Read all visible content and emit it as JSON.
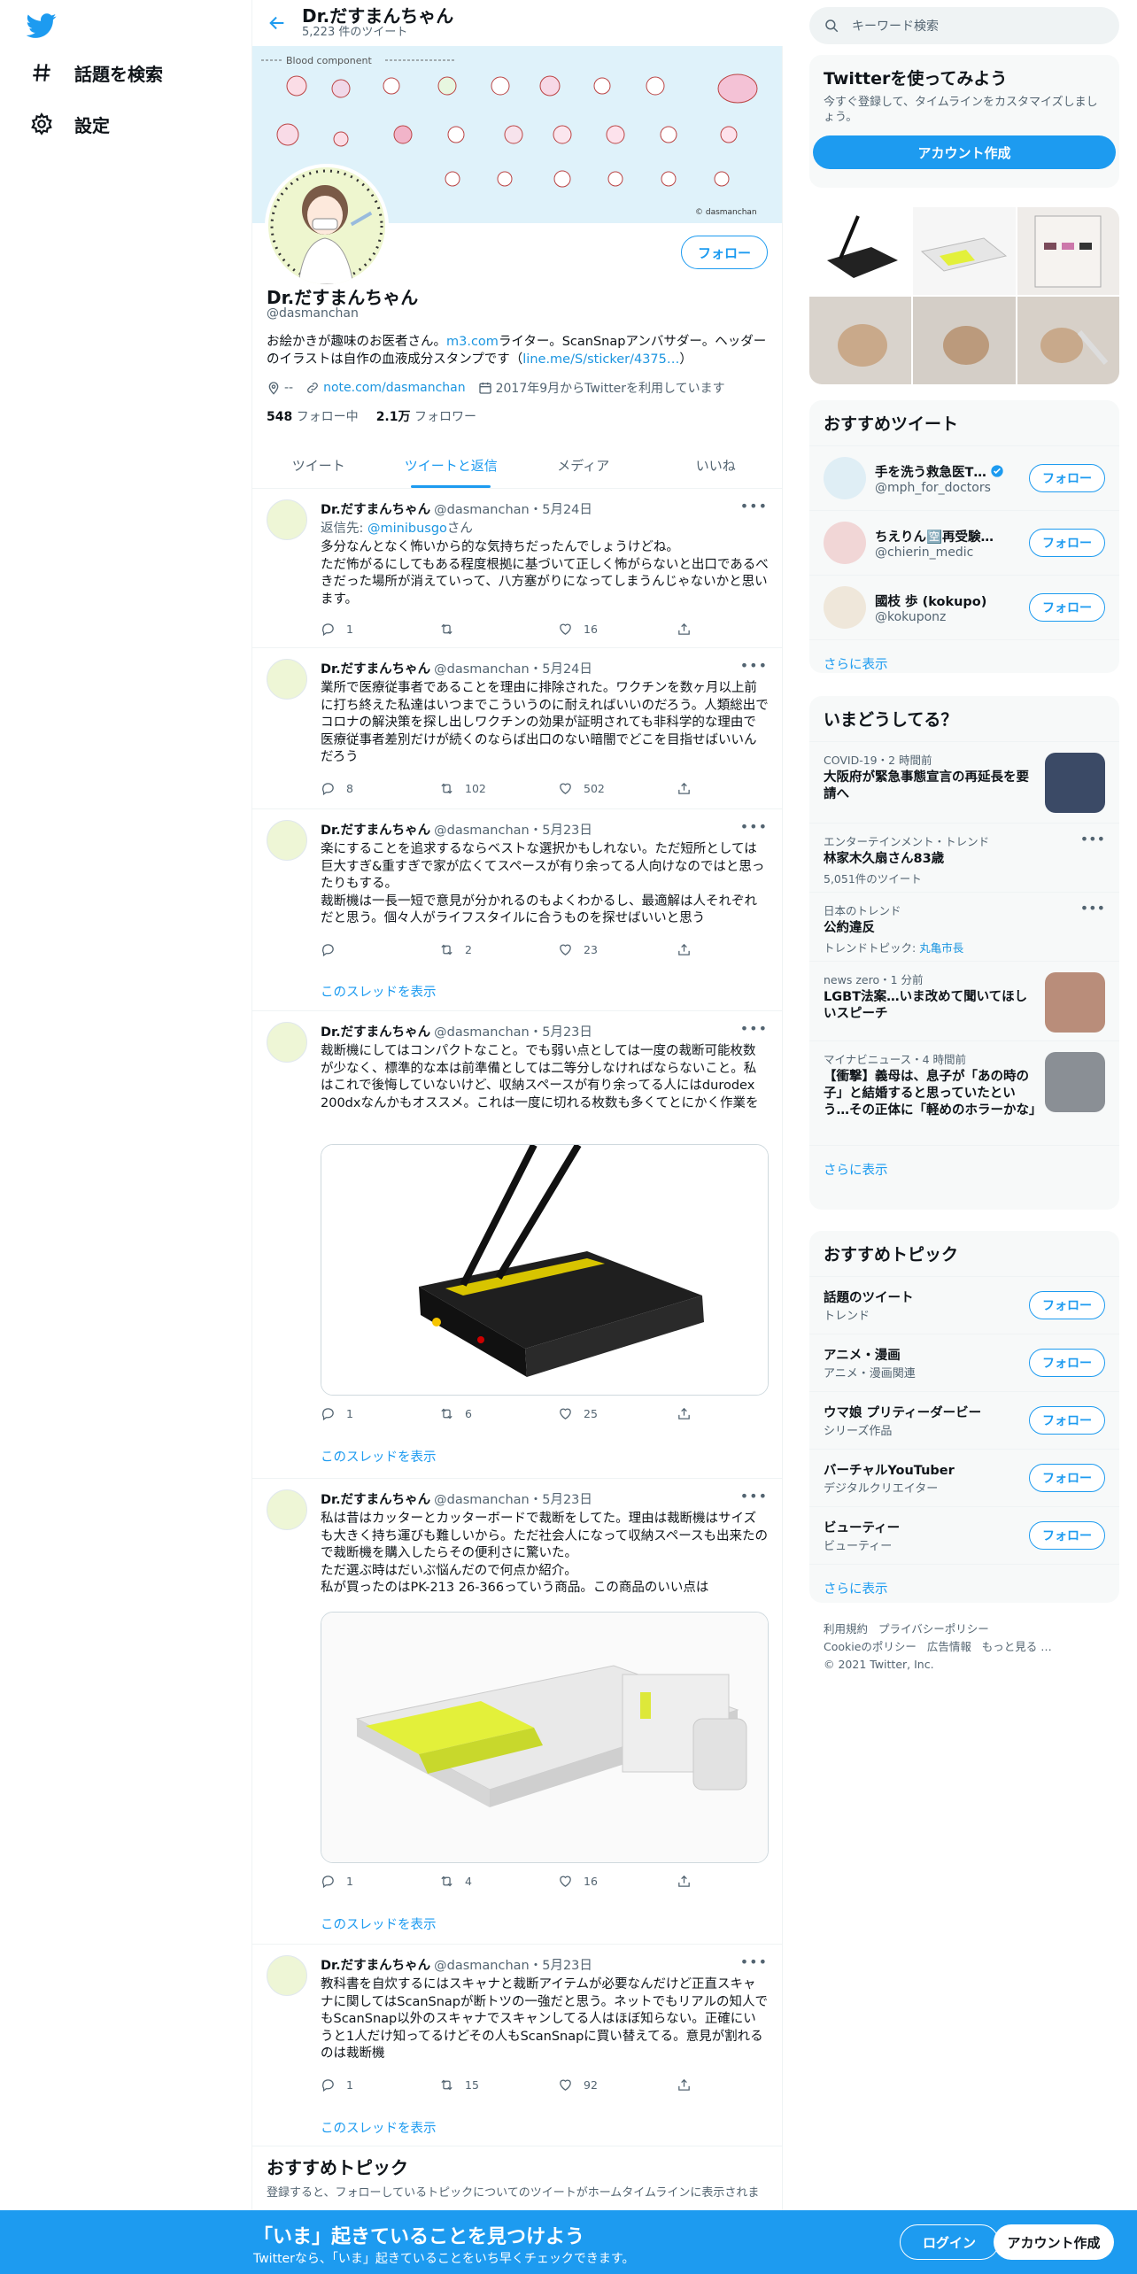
{
  "nav": {
    "explore": "話題を検索",
    "settings": "設定"
  },
  "profile": {
    "header_name": "Dr.だすまんちゃん",
    "tweet_count": "5,223 件のツイート",
    "follow_button": "フォロー",
    "name": "Dr.だすまんちゃん",
    "handle": "@dasmanchan",
    "bio_pre": "お絵かきが趣味のお医者さん。",
    "bio_link1": "m3.com",
    "bio_mid": "ライター。ScanSnapアンバサダー。ヘッダーのイラストは自作の血液成分スタンプです（",
    "bio_link2": "line.me/S/sticker/4375…",
    "bio_post": "）",
    "location": "--",
    "website": "note.com/dasmanchan",
    "joined": "2017年9月からTwitterを利用しています",
    "following_count": "548",
    "following_label": "フォロー中",
    "followers_count": "2.1万",
    "followers_label": "フォロワー",
    "banner_caption": "Blood component",
    "banner_credit": "© dasmanchan"
  },
  "tabs": [
    "ツイート",
    "ツイートと返信",
    "メディア",
    "いいね"
  ],
  "tweets": [
    {
      "name": "Dr.だすまんちゃん",
      "meta": "@dasmanchan・5月24日",
      "reply_prefix": "返信先: ",
      "reply_to": "@minibusgo",
      "reply_suffix": "さん",
      "body": "多分なんとなく怖いから的な気持ちだったんでしょうけどね。\nただ怖がるにしてもある程度根拠に基づいて正しく怖がらないと出口であるべきだった場所が消えていって、八方塞がりになってしまうんじゃないかと思います。",
      "reply": "1",
      "retweet": "",
      "like": "16"
    },
    {
      "name": "Dr.だすまんちゃん",
      "meta": "@dasmanchan・5月24日",
      "body": "業所で医療従事者であることを理由に排除された。ワクチンを数ヶ月以上前に打ち終えた私達はいつまでこういうのに耐えればいいのだろう。人類総出でコロナの解決策を探し出しワクチンの効果が証明されても非科学的な理由で医療従事者差別だけが続くのならば出口のない暗闇でどこを目指せばいいんだろう",
      "reply": "8",
      "retweet": "102",
      "like": "502"
    },
    {
      "name": "Dr.だすまんちゃん",
      "meta": "@dasmanchan・5月23日",
      "body": "楽にすることを追求するならベストな選択かもしれない。ただ短所としては巨大すぎ&重すぎで家が広くてスペースが有り余ってる人向けなのではと思ったりもする。\n裁断機は一長一短で意見が分かれるのもよくわかるし、最適解は人それぞれだと思う。個々人がライフスタイルに合うものを探せばいいと思う",
      "reply": "",
      "retweet": "2",
      "like": "23",
      "thread": "このスレッドを表示"
    },
    {
      "name": "Dr.だすまんちゃん",
      "meta": "@dasmanchan・5月23日",
      "body": "裁断機にしてはコンパクトなこと。でも弱い点としては一度の裁断可能枚数が少なく、標準的な本は前準備としては二等分しなければならないこと。私はこれで後悔していないけど、収納スペースが有り余ってる人にはdurodex 200dxなんかもオススメ。これは一度に切れる枚数も多くてとにかく作業を",
      "reply": "1",
      "retweet": "6",
      "like": "25",
      "thread": "このスレッドを表示"
    },
    {
      "name": "Dr.だすまんちゃん",
      "meta": "@dasmanchan・5月23日",
      "body": "私は昔はカッターとカッターボードで裁断をしてた。理由は裁断機はサイズも大きく持ち運びも難しいから。ただ社会人になって収納スペースも出来たので裁断機を購入したらその便利さに驚いた。\nただ選ぶ時はだいぶ悩んだので何点か紹介。\n私が買ったのはPK-213 26-366っていう商品。この商品のいい点は",
      "reply": "1",
      "retweet": "4",
      "like": "16",
      "thread": "このスレッドを表示"
    },
    {
      "name": "Dr.だすまんちゃん",
      "meta": "@dasmanchan・5月23日",
      "body": "教科書を自炊するにはスキャナと裁断アイテムが必要なんだけど正直スキャナに関してはScanSnapが断トツの一強だと思う。ネットでもリアルの知人でもScanSnap以外のスキャナでスキャンしてる人はほぼ知らない。正確にいうと1人だけ知ってるけどその人もScanSnapに買い替えてる。意見が割れるのは裁断機",
      "reply": "1",
      "retweet": "15",
      "like": "92",
      "thread": "このスレッドを表示"
    }
  ],
  "main_rec_topics": {
    "title": "おすすめトピック",
    "desc": "登録すると、フォローしているトピックについてのツイートがホームタイムラインに表示されま"
  },
  "sidebar": {
    "search_placeholder": "キーワード検索",
    "signup": {
      "title": "Twitterを使ってみよう",
      "desc": "今すぐ登録して、タイムラインをカスタマイズしましょう。",
      "button": "アカウント作成"
    },
    "who_to_follow": {
      "title": "おすすめツイート",
      "users": [
        {
          "name": "手を洗う救急医T…",
          "handle": "@mph_for_doctors",
          "verified": true
        },
        {
          "name": "ちえりん🈳再受験…",
          "handle": "@chierin_medic",
          "verified": false
        },
        {
          "name": "國枝 歩 (kokupo)",
          "handle": "@kokuponz",
          "verified": false
        }
      ],
      "follow_label": "フォロー",
      "show_more": "さらに表示"
    },
    "trends": {
      "title": "いまどうしてる？",
      "items": [
        {
          "meta": "COVID-19・2 時間前",
          "title": "大阪府が緊急事態宣言の再延長を要請へ",
          "count": "",
          "extra_prefix": "",
          "extra_link": "",
          "thumb": true,
          "dots": false
        },
        {
          "meta": "エンターテインメント・トレンド",
          "title": "林家木久扇さん83歳",
          "count": "5,051件のツイート",
          "extra_prefix": "",
          "extra_link": "",
          "thumb": false,
          "dots": true
        },
        {
          "meta": "日本のトレンド",
          "title": "公約違反",
          "count": "",
          "extra_prefix": "トレンドトピック: ",
          "extra_link": "丸亀市長",
          "thumb": false,
          "dots": true
        },
        {
          "meta": "news zero・1 分前",
          "title": "LGBT法案…いま改めて聞いてほしいスピーチ",
          "count": "",
          "extra_prefix": "",
          "extra_link": "",
          "thumb": true,
          "dots": false
        },
        {
          "meta": "マイナビニュース・4 時間前",
          "title": "【衝撃】義母は、息子が「あの時の子」と結婚すると思っていたという…その正体に「軽めのホラーかな」",
          "count": "",
          "extra_prefix": "",
          "extra_link": "",
          "thumb": true,
          "dots": false
        }
      ],
      "show_more": "さらに表示"
    },
    "topics": {
      "title": "おすすめトピック",
      "items": [
        {
          "name": "話題のツイート",
          "sub": "トレンド"
        },
        {
          "name": "アニメ・漫画",
          "sub": "アニメ・漫画関連"
        },
        {
          "name": "ウマ娘 プリティーダービー",
          "sub": "シリーズ作品"
        },
        {
          "name": "バーチャルYouTuber",
          "sub": "デジタルクリエイター"
        },
        {
          "name": "ビューティー",
          "sub": "ビューティー"
        }
      ],
      "follow_label": "フォロー",
      "show_more": "さらに表示"
    },
    "footer": {
      "terms": "利用規約",
      "privacy": "プライバシーポリシー",
      "cookie": "Cookieのポリシー",
      "ads": "広告情報",
      "more": "もっと見る …",
      "copyright": "© 2021 Twitter, Inc."
    }
  },
  "bottom_bar": {
    "headline": "「いま」起きていることを見つけよう",
    "sub": "Twitterなら、「いま」起きていることをいち早くチェックできます。",
    "login": "ログイン",
    "signup": "アカウント作成"
  },
  "colors": {
    "accent": "#1d9bf0",
    "bottom_bar": "#1d9bf0",
    "text": "#0f1419",
    "muted": "#536471"
  }
}
